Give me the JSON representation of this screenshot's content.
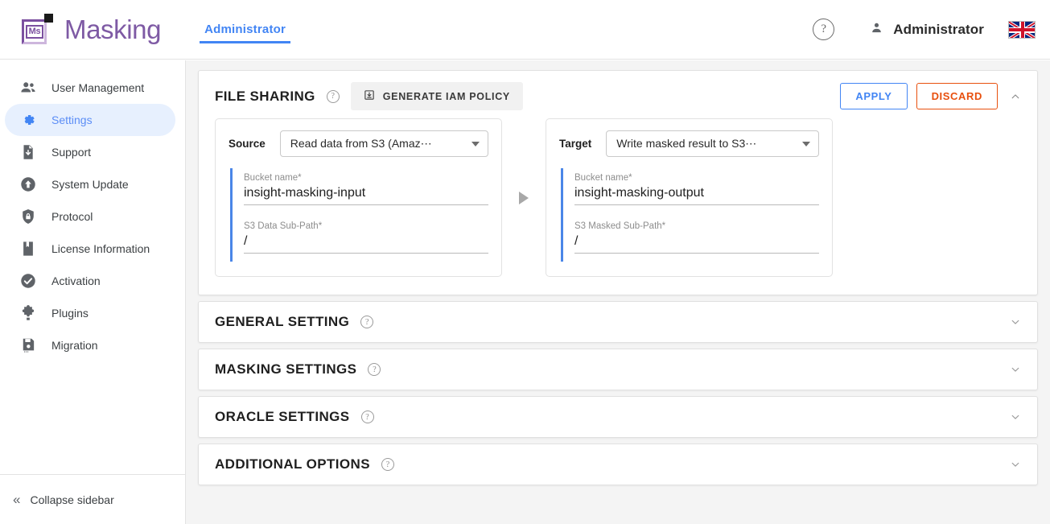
{
  "header": {
    "brand_name": "Masking",
    "logo_text": "Ms",
    "tab_label": "Administrator",
    "help_icon": "help-circle-icon",
    "user_icon": "person-icon",
    "user_name": "Administrator",
    "flag_icon": "uk-flag-icon"
  },
  "sidebar": {
    "items": [
      {
        "label": "User Management",
        "icon": "users-icon",
        "active": false
      },
      {
        "label": "Settings",
        "icon": "gear-icon",
        "active": true
      },
      {
        "label": "Support",
        "icon": "document-download-icon",
        "active": false
      },
      {
        "label": "System Update",
        "icon": "arrow-up-circle-icon",
        "active": false
      },
      {
        "label": "Protocol",
        "icon": "shield-lock-icon",
        "active": false
      },
      {
        "label": "License Information",
        "icon": "bookmark-icon",
        "active": false
      },
      {
        "label": "Activation",
        "icon": "check-circle-icon",
        "active": false
      },
      {
        "label": "Plugins",
        "icon": "puzzle-piece-icon",
        "active": false
      },
      {
        "label": "Migration",
        "icon": "save-disk-icon",
        "active": false
      }
    ],
    "collapse_label": "Collapse sidebar",
    "collapse_icon": "double-chevron-left-icon"
  },
  "file_sharing": {
    "title": "FILE SHARING",
    "help_icon": "help-circle-icon",
    "iam_button_label": "GENERATE IAM POLICY",
    "iam_button_icon": "download-box-icon",
    "apply_label": "APPLY",
    "discard_label": "DISCARD",
    "collapse_icon": "chevron-up-icon",
    "flow_icon": "play-triangle-icon",
    "source": {
      "label": "Source",
      "select_value": "Read data from S3 (Amaz⋯",
      "dropdown_icon": "chevron-down-icon",
      "fields": [
        {
          "label": "Bucket name*",
          "value": "insight-masking-input"
        },
        {
          "label": "S3 Data Sub-Path*",
          "value": "/"
        }
      ]
    },
    "target": {
      "label": "Target",
      "select_value": "Write masked result to S3⋯",
      "dropdown_icon": "chevron-down-icon",
      "fields": [
        {
          "label": "Bucket name*",
          "value": "insight-masking-output"
        },
        {
          "label": "S3 Masked Sub-Path*",
          "value": "/"
        }
      ]
    }
  },
  "sections": [
    {
      "title": "GENERAL SETTING",
      "help_icon": "help-circle-icon",
      "expand_icon": "chevron-down-icon"
    },
    {
      "title": "MASKING SETTINGS",
      "help_icon": "help-circle-icon",
      "expand_icon": "chevron-down-icon"
    },
    {
      "title": "ORACLE SETTINGS",
      "help_icon": "help-circle-icon",
      "expand_icon": "chevron-down-icon"
    },
    {
      "title": "ADDITIONAL OPTIONS",
      "help_icon": "help-circle-icon",
      "expand_icon": "chevron-down-icon"
    }
  ],
  "colors": {
    "accent_blue": "#4285f4",
    "brand_purple": "#7e5aa4",
    "discard_orange": "#e8500e",
    "field_bar_blue": "#4a86e8"
  },
  "glyphs": {
    "question": "?",
    "double_chevron_left": "«"
  }
}
